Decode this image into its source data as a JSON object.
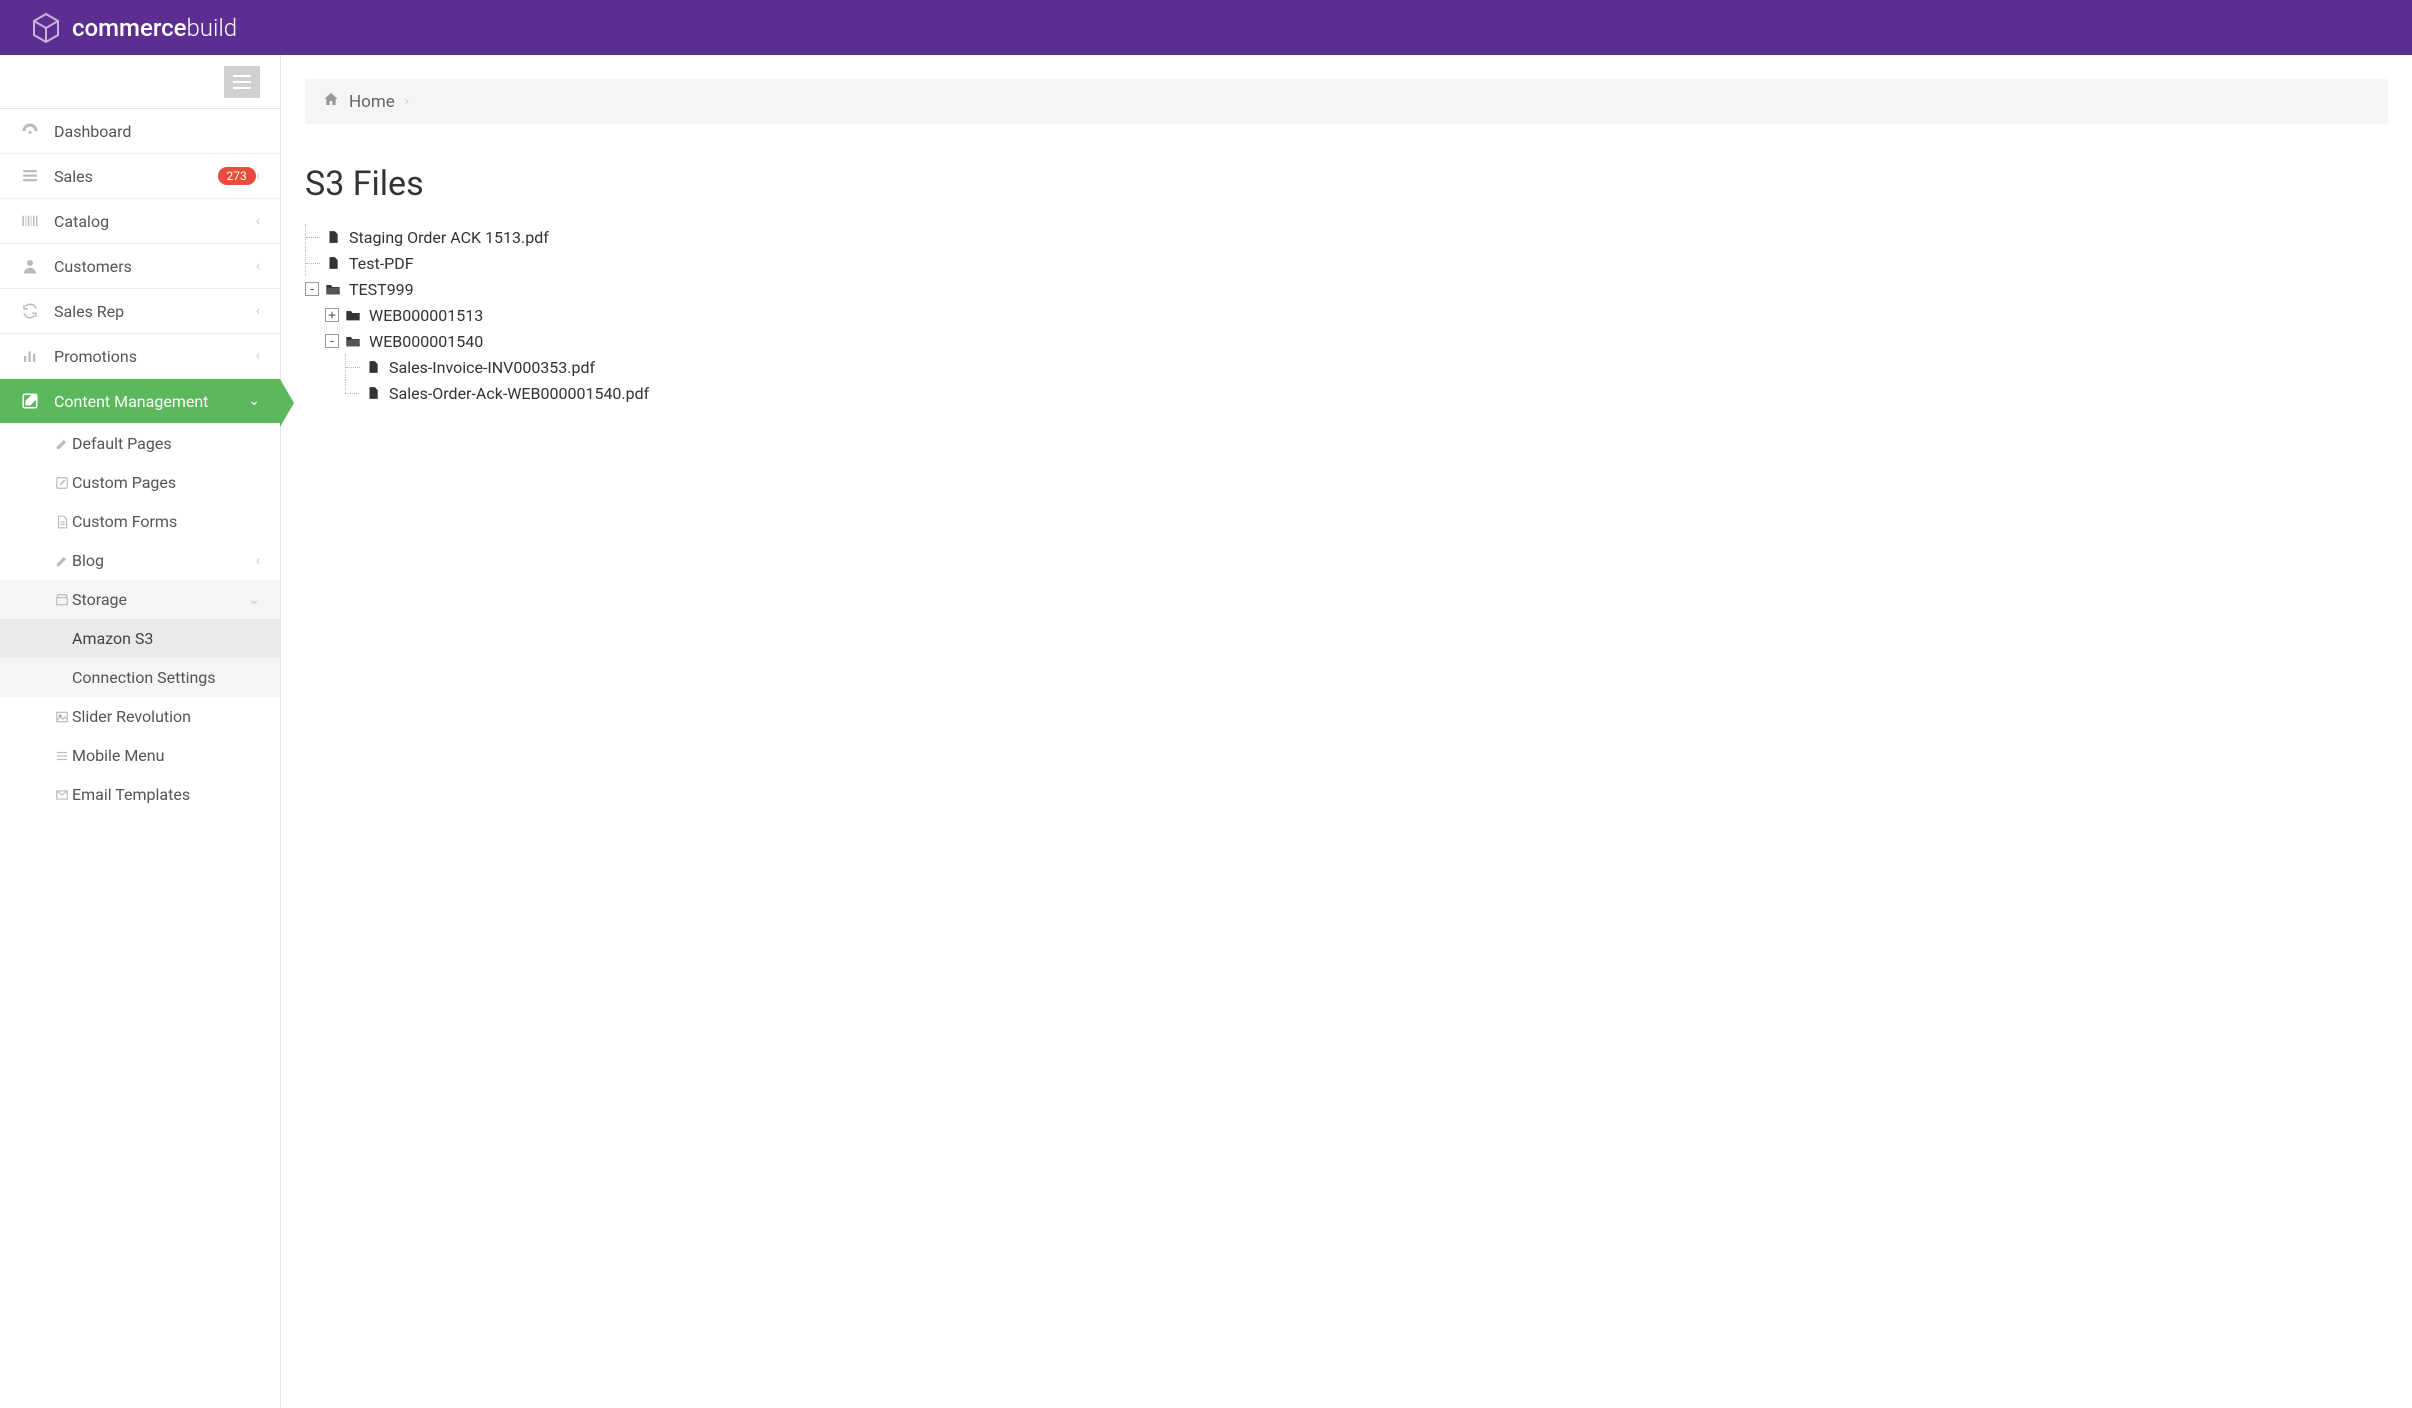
{
  "brand": {
    "name_strong": "commerce",
    "name_light": "build"
  },
  "sidebar": {
    "items": [
      {
        "label": "Dashboard",
        "icon": "dashboard",
        "chevron": false
      },
      {
        "label": "Sales",
        "icon": "list",
        "chevron": true,
        "badge": "273"
      },
      {
        "label": "Catalog",
        "icon": "barcode",
        "chevron": true
      },
      {
        "label": "Customers",
        "icon": "user",
        "chevron": true
      },
      {
        "label": "Sales Rep",
        "icon": "refresh",
        "chevron": true
      },
      {
        "label": "Promotions",
        "icon": "chart",
        "chevron": true
      },
      {
        "label": "Content Management",
        "icon": "edit",
        "chevron": true,
        "active": true
      }
    ],
    "content_submenu": [
      {
        "label": "Default Pages",
        "icon": "pencil"
      },
      {
        "label": "Custom Pages",
        "icon": "square-edit"
      },
      {
        "label": "Custom Forms",
        "icon": "doc"
      },
      {
        "label": "Blog",
        "icon": "pencil",
        "chevron": true
      },
      {
        "label": "Storage",
        "icon": "box",
        "chevron": true,
        "expanded": true
      },
      {
        "label": "Slider Revolution",
        "icon": "image"
      },
      {
        "label": "Mobile Menu",
        "icon": "menu"
      },
      {
        "label": "Email Templates",
        "icon": "mail"
      }
    ],
    "storage_submenu": [
      {
        "label": "Amazon S3",
        "selected": true
      },
      {
        "label": "Connection Settings"
      }
    ]
  },
  "breadcrumb": {
    "home": "Home"
  },
  "page": {
    "title": "S3 Files"
  },
  "tree": {
    "root": [
      {
        "type": "file",
        "label": "Staging Order ACK 1513.pdf"
      },
      {
        "type": "file",
        "label": "Test-PDF"
      },
      {
        "type": "folder-open",
        "label": "TEST999",
        "toggle": "-",
        "children": [
          {
            "type": "folder",
            "label": "WEB000001513",
            "toggle": "+"
          },
          {
            "type": "folder-open",
            "label": "WEB000001540",
            "toggle": "-",
            "children": [
              {
                "type": "file",
                "label": "Sales-Invoice-INV000353.pdf"
              },
              {
                "type": "file",
                "label": "Sales-Order-Ack-WEB000001540.pdf"
              }
            ]
          }
        ]
      }
    ]
  }
}
